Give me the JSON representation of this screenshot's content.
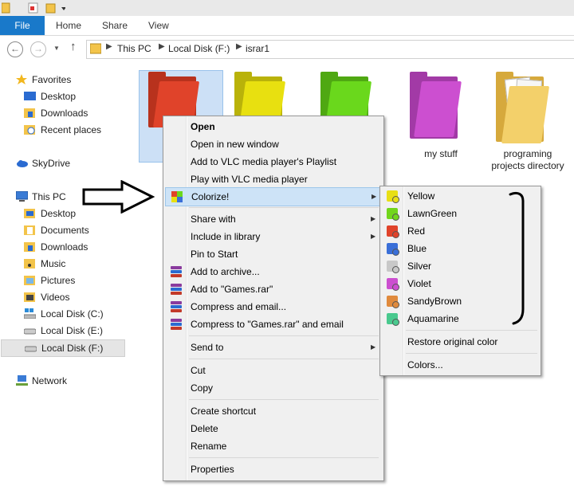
{
  "ribbon": {
    "file": "File",
    "home": "Home",
    "share": "Share",
    "view": "View"
  },
  "address": {
    "crumbs": [
      "This PC",
      "Local Disk (F:)",
      "israr1"
    ]
  },
  "nav": {
    "favorites": "Favorites",
    "fav_items": [
      "Desktop",
      "Downloads",
      "Recent places"
    ],
    "skydrive": "SkyDrive",
    "thispc": "This PC",
    "pc_items": [
      "Desktop",
      "Documents",
      "Downloads",
      "Music",
      "Pictures",
      "Videos",
      "Local Disk (C:)",
      "Local Disk (E:)",
      "Local Disk (F:)"
    ],
    "network": "Network"
  },
  "folders": [
    {
      "label": "",
      "color": "#e0432a"
    },
    {
      "label": "",
      "color": "#e8e010"
    },
    {
      "label": "",
      "color": "#6ad81c"
    },
    {
      "label": "my stuff",
      "color": "#cc4fd0"
    },
    {
      "label": "programing projects directory",
      "color": "#f3d06a"
    }
  ],
  "context_menu": {
    "items": [
      "Open",
      "Open in new window",
      "Add to VLC media player's Playlist",
      "Play with VLC media player",
      "Colorize!",
      "Share with",
      "Include in library",
      "Pin to Start",
      "Add to archive...",
      "Add to \"Games.rar\"",
      "Compress and email...",
      "Compress to \"Games.rar\" and email",
      "Send to",
      "Cut",
      "Copy",
      "Create shortcut",
      "Delete",
      "Rename",
      "Properties"
    ]
  },
  "colorize_menu": {
    "colors": [
      {
        "label": "Yellow",
        "color": "#e8df14"
      },
      {
        "label": "LawnGreen",
        "color": "#72d61c"
      },
      {
        "label": "Red",
        "color": "#e0432a"
      },
      {
        "label": "Blue",
        "color": "#3a6fd8"
      },
      {
        "label": "Silver",
        "color": "#c8c8c8"
      },
      {
        "label": "Violet",
        "color": "#cc4fd0"
      },
      {
        "label": "SandyBrown",
        "color": "#e08a3c"
      },
      {
        "label": "Aquamarine",
        "color": "#49c98e"
      }
    ],
    "restore": "Restore original color",
    "colors_dialog": "Colors..."
  },
  "theme": {
    "accent": "#1979ca",
    "highlight": "#cde3f7"
  }
}
